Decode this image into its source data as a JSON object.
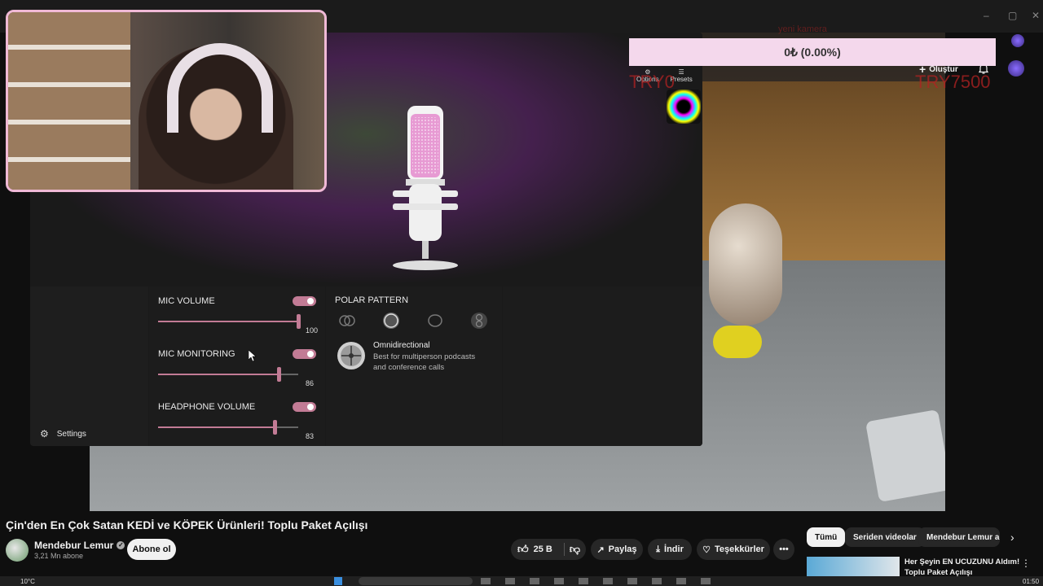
{
  "window": {
    "minimize": "–",
    "maximize": "▢",
    "close": "✕"
  },
  "stream_overlay": {
    "donation": "0₺ (0.00%)",
    "goal_left": "TRY0",
    "goal_right": "TRY7500",
    "faded_text": "yeni kamera"
  },
  "youtube_top": {
    "create_label": "Oluştur"
  },
  "ngenuity": {
    "top_tabs": [
      {
        "label": "Options",
        "icon": "sliders-icon"
      },
      {
        "label": "Presets",
        "icon": "sliders-icon"
      }
    ],
    "settings_label": "Settings",
    "sliders": [
      {
        "label": "MIC VOLUME",
        "value": "100",
        "level": 1.0,
        "enabled": true
      },
      {
        "label": "MIC MONITORING",
        "value": "86",
        "level": 0.86,
        "enabled": true
      },
      {
        "label": "HEADPHONE VOLUME",
        "value": "83",
        "level": 0.83,
        "enabled": true
      }
    ],
    "polar": {
      "heading": "POLAR PATTERN",
      "patterns": [
        "stereo-icon",
        "omnidirectional-icon",
        "cardioid-icon",
        "bidirectional-icon"
      ],
      "selected_name": "Omnidirectional",
      "selected_desc_1": "Best for multiperson podcasts",
      "selected_desc_2": "and conference calls"
    },
    "accent": "#c27b95"
  },
  "video": {
    "title": "Çin'den En Çok Satan KEDİ ve KÖPEK Ürünleri! Toplu Paket Açılışı",
    "channel": "Mendebur Lemur",
    "subscribers": "3,21 Mn abone",
    "subscribe_label": "Abone ol",
    "likes": "25 B",
    "share_label": "Paylaş",
    "download_label": "İndir",
    "thanks_label": "Teşekkürler"
  },
  "recommend": {
    "chips": [
      "Tümü",
      "Seriden videolar",
      "Mendebur Lemur adlı"
    ],
    "next_video_title": "Her Şeyin EN UCUZUNU Aldım!",
    "next_video_title2": "Toplu Paket Açılışı"
  },
  "taskbar": {
    "temperature": "10°C",
    "time": "01:50"
  }
}
